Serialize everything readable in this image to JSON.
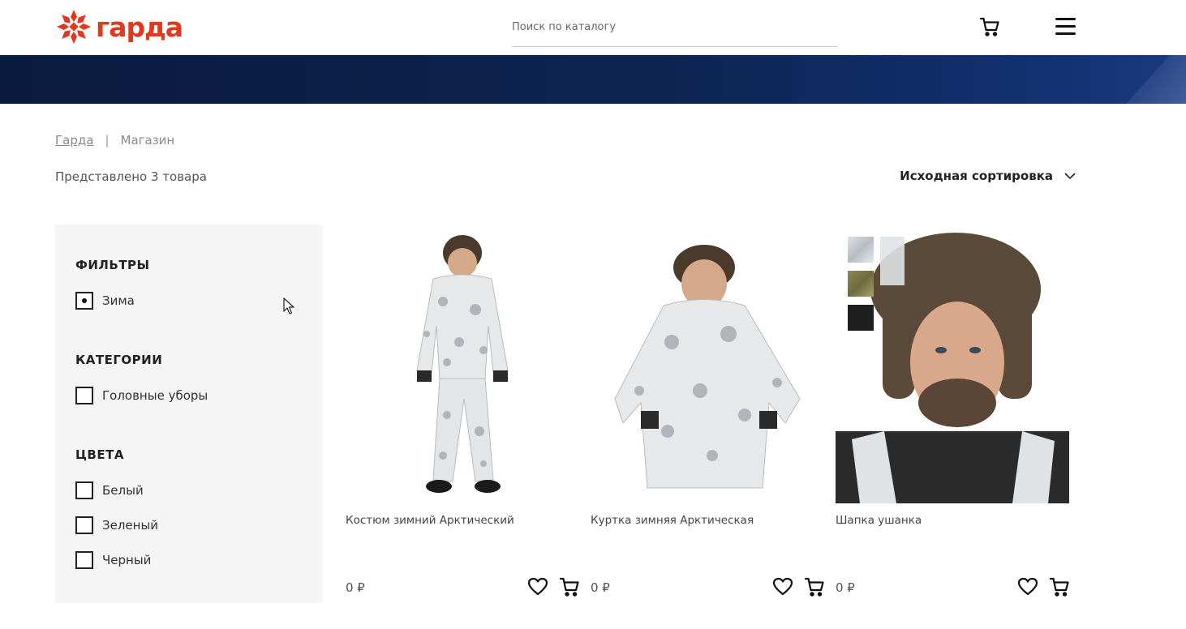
{
  "header": {
    "logo_text": "гарда",
    "search_placeholder": "Поиск по каталогу",
    "cart_icon": "cart-icon",
    "menu_icon": "hamburger-menu-icon"
  },
  "colors": {
    "brand": "#e03a1e",
    "banner": "#0d2452",
    "sidebar_bg": "#f5f5f5"
  },
  "breadcrumb": {
    "home": "Гарда",
    "separator": "|",
    "current": "Магазин"
  },
  "catalog": {
    "result_count": "Представлено 3 товара",
    "sort_label": "Исходная сортировка"
  },
  "sidebar": {
    "filters_title": "ФИЛЬТРЫ",
    "filters": [
      {
        "label": "Зима",
        "checked": true
      }
    ],
    "categories_title": "КАТЕГОРИИ",
    "categories": [
      {
        "label": "Головные уборы",
        "checked": false
      }
    ],
    "colors_title": "ЦВЕТА",
    "colors": [
      {
        "label": "Белый",
        "checked": false
      },
      {
        "label": "Зеленый",
        "checked": false
      },
      {
        "label": "Черный",
        "checked": false
      }
    ]
  },
  "products": [
    {
      "name": "Костюм зимний Арктический",
      "price": "0 ₽"
    },
    {
      "name": "Куртка зимняя Арктическая",
      "price": "0 ₽"
    },
    {
      "name": "Шапка ушанка",
      "price": "0 ₽"
    }
  ]
}
